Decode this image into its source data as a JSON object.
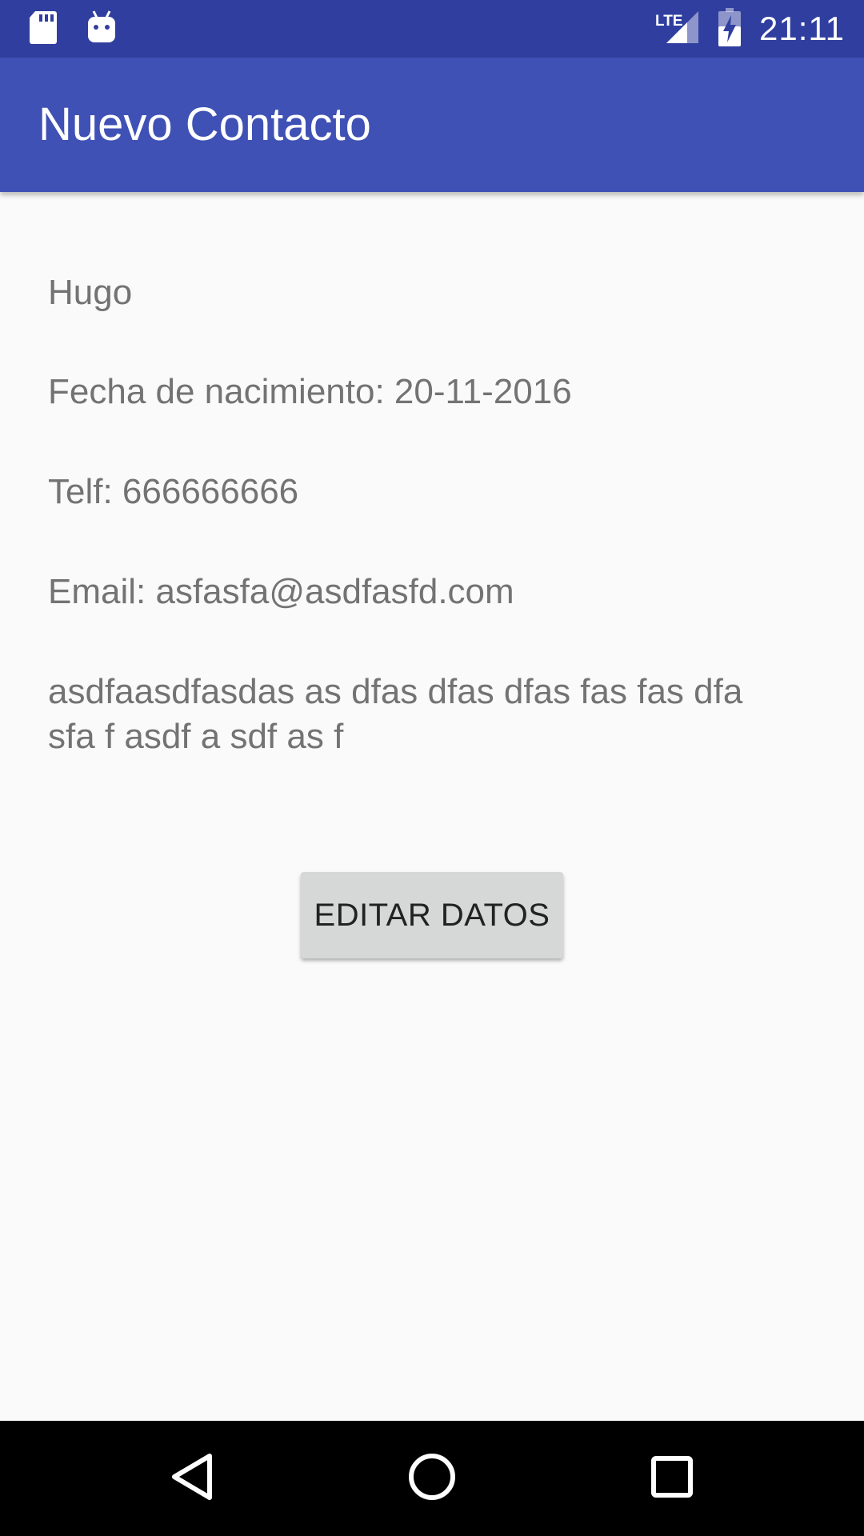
{
  "status_bar": {
    "time": "21:11",
    "network_label": "LTE",
    "icons": [
      "sd-card-icon",
      "android-icon",
      "lte-signal-icon",
      "battery-charging-icon"
    ],
    "background_color": "#303f9f"
  },
  "app_bar": {
    "title": "Nuevo Contacto",
    "background_color": "#3f51b5"
  },
  "contact": {
    "name": "Hugo",
    "birth_date": "Fecha de nacimiento:  20-11-2016",
    "phone": "Telf:  666666666",
    "email": "Email:  asfasfa@asdfasfd.com",
    "description": "asdfaasdfasdas as dfas dfas dfas fas fas dfa sfa f asdf a sdf as f"
  },
  "actions": {
    "edit_label": "EDITAR DATOS"
  },
  "nav_bar": {
    "icons": [
      "back-icon",
      "home-icon",
      "recents-icon"
    ]
  }
}
